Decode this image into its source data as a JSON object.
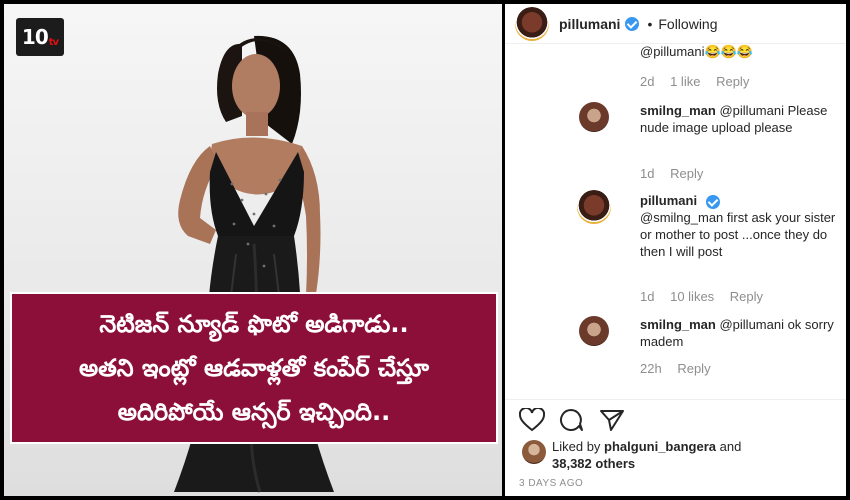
{
  "logo": {
    "main": "10",
    "suffix": "tv"
  },
  "headline": {
    "line1": "నెటిజన్ న్యూడ్ ఫొటో అడిగాడు..",
    "line2": "అతని ఇంట్లో ఆడవాళ్లతో కంపేర్ చేస్తూ",
    "line3": "అదిరిపోయే ఆన్సర్ ఇచ్చింది.."
  },
  "post": {
    "username": "pillumani",
    "separator": "•",
    "follow_state": "Following"
  },
  "comments": {
    "partial_text": "@pillumani😂😂😂",
    "partial_meta": {
      "time": "2d",
      "likes": "1 like",
      "reply": "Reply"
    },
    "items": [
      {
        "username": "smilng_man",
        "text": " @pillumani Please nude image upload please",
        "time": "1d",
        "likes": "",
        "reply": "Reply"
      },
      {
        "username": "pillumani",
        "text": "@smilng_man first ask your sister or mother to post ...once they do then I will post",
        "time": "1d",
        "likes": "10 likes",
        "reply": "Reply"
      },
      {
        "username": "smilng_man",
        "text": " @pillumani ok sorry madem",
        "time": "22h",
        "likes": "",
        "reply": "Reply"
      }
    ]
  },
  "likes": {
    "prefix": "Liked by ",
    "user": "phalguni_bangera",
    "middle": " and",
    "count": "38,382 others"
  },
  "timestamp": "3 DAYS AGO",
  "colors": {
    "headline_bg": "#8c0f3a",
    "verified": "#3897f0",
    "muted": "#8e8e8e"
  },
  "icons": [
    "heart-icon",
    "comment-icon",
    "share-icon",
    "verified-icon"
  ]
}
